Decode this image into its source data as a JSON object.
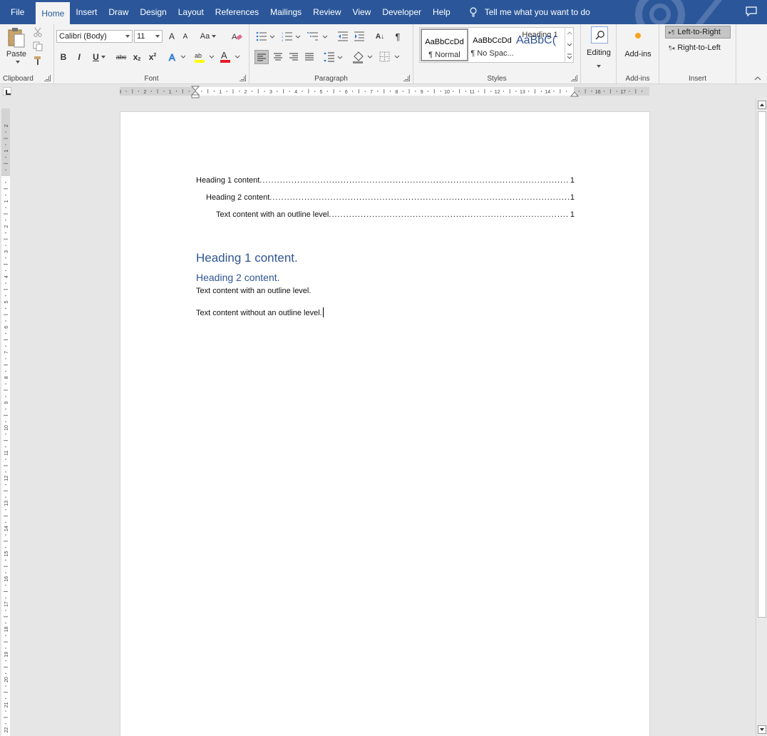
{
  "menu": {
    "tabs": [
      "File",
      "Home",
      "Insert",
      "Draw",
      "Design",
      "Layout",
      "References",
      "Mailings",
      "Review",
      "View",
      "Developer",
      "Help"
    ],
    "active_tab": "Home",
    "tell_me": "Tell me what you want to do"
  },
  "ribbon": {
    "clipboard": {
      "paste_label": "Paste",
      "group_label": "Clipboard"
    },
    "font": {
      "font_name": "Calibri (Body)",
      "font_size": "11",
      "group_label": "Font",
      "grow": "A",
      "shrink": "A",
      "case": "Aa",
      "bold": "B",
      "italic": "I",
      "underline": "U",
      "strike": "abc",
      "sub": "x",
      "sup": "x",
      "color_a": "A"
    },
    "paragraph": {
      "group_label": "Paragraph",
      "sort": "A↓",
      "pilcrow": "¶"
    },
    "styles": {
      "group_label": "Styles",
      "items": [
        {
          "sample": "AaBbCcDd",
          "name": "¶ Normal"
        },
        {
          "sample": "AaBbCcDd",
          "name": "¶ No Spac..."
        },
        {
          "sample": "AaBbC(",
          "name": "Heading 1"
        }
      ]
    },
    "editing": {
      "label": "Editing"
    },
    "addins": {
      "label": "Add-ins",
      "group_label": "Add-ins"
    },
    "insert": {
      "ltr": "Left-to-Right",
      "rtl": "Right-to-Left",
      "group_label": "Insert"
    }
  },
  "ruler": {
    "h_labels": [
      "3",
      "2",
      "1",
      "",
      "1",
      "2",
      "3",
      "4",
      "5",
      "6",
      "7",
      "8",
      "9",
      "10",
      "11",
      "12",
      "13",
      "14",
      "",
      "16",
      "17"
    ],
    "v_labels": [
      "2",
      "1",
      "",
      "1",
      "2",
      "3",
      "4",
      "5",
      "6",
      "7",
      "8",
      "9",
      "10",
      "11",
      "12",
      "13",
      "14",
      "15",
      "16",
      "17",
      "18",
      "19",
      "20",
      "21",
      "22"
    ]
  },
  "document": {
    "toc": [
      {
        "text": "Heading 1 content.",
        "page": "1"
      },
      {
        "text": "Heading 2 content.",
        "page": "1"
      },
      {
        "text": "Text content with an outline level.",
        "page": "1"
      }
    ],
    "heading1": "Heading 1 content.",
    "heading2": "Heading 2 content.",
    "body1": "Text content with an outline level.",
    "body2": "Text content without an outline level."
  },
  "colors": {
    "accent": "#2b579a",
    "heading": "#2f5496"
  }
}
